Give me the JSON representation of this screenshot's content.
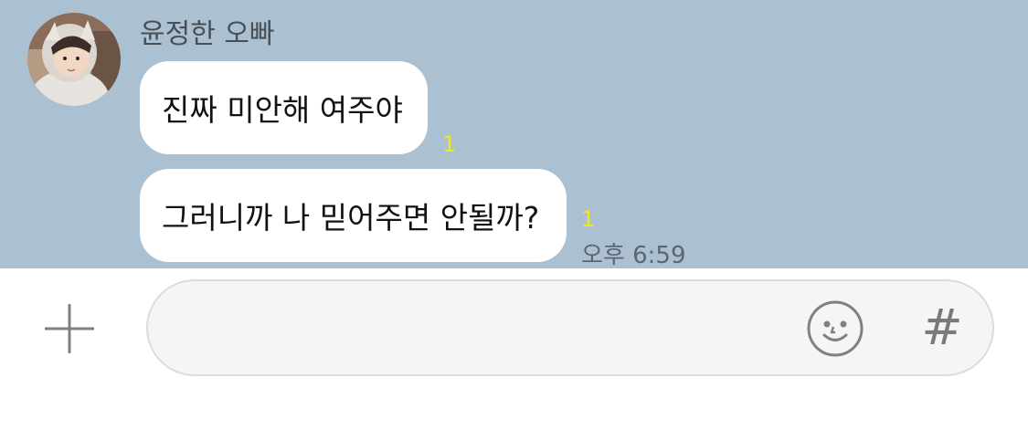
{
  "chat": {
    "sender_name": "윤정한 오빠",
    "avatar_icon": "profile-photo",
    "messages": [
      {
        "text": "진짜 미안해 여주야",
        "unread_count": "1"
      },
      {
        "text": "그러니까 나 믿어주면 안될까?",
        "unread_count": "1",
        "time": "오후 6:59"
      }
    ],
    "colors": {
      "background": "#abc1d1",
      "bubble": "#ffffff",
      "unread": "#f6e51d"
    }
  },
  "input_bar": {
    "plus_icon": "plus-icon",
    "placeholder": "",
    "value": "",
    "emoji_icon": "emoji-icon",
    "hash_label": "#"
  }
}
